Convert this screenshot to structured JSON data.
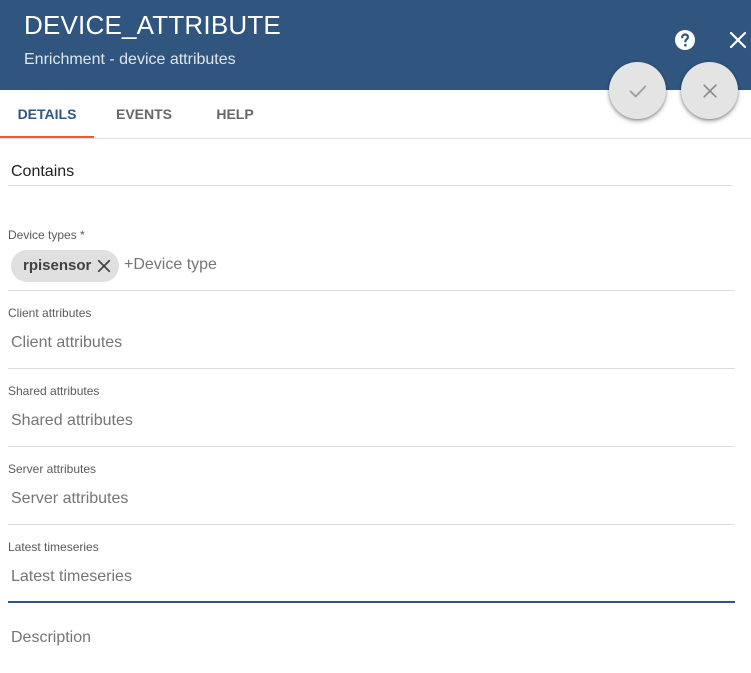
{
  "header": {
    "title": "DEVICE_ATTRIBUTE",
    "subtitle": "Enrichment - device attributes",
    "help_icon": "help-circle-icon",
    "close_icon": "close-icon",
    "background": "#305680"
  },
  "actions": {
    "apply_icon": "check-icon",
    "cancel_icon": "close-icon"
  },
  "tabs": [
    {
      "label": "DETAILS",
      "active": true
    },
    {
      "label": "EVENTS",
      "active": false
    },
    {
      "label": "HELP",
      "active": false
    }
  ],
  "form": {
    "name_value": "Contains",
    "device_types": {
      "label": "Device types *",
      "chips": [
        "rpisensor"
      ],
      "placeholder": "+Device type"
    },
    "client_attributes": {
      "label": "Client attributes",
      "placeholder": "Client attributes"
    },
    "shared_attributes": {
      "label": "Shared attributes",
      "placeholder": "Shared attributes"
    },
    "server_attributes": {
      "label": "Server attributes",
      "placeholder": "Server attributes"
    },
    "latest_timeseries": {
      "label": "Latest timeseries",
      "placeholder": "Latest timeseries"
    },
    "description": {
      "placeholder": "Description"
    }
  },
  "colors": {
    "accent": "#ff5722",
    "primary": "#305680"
  }
}
